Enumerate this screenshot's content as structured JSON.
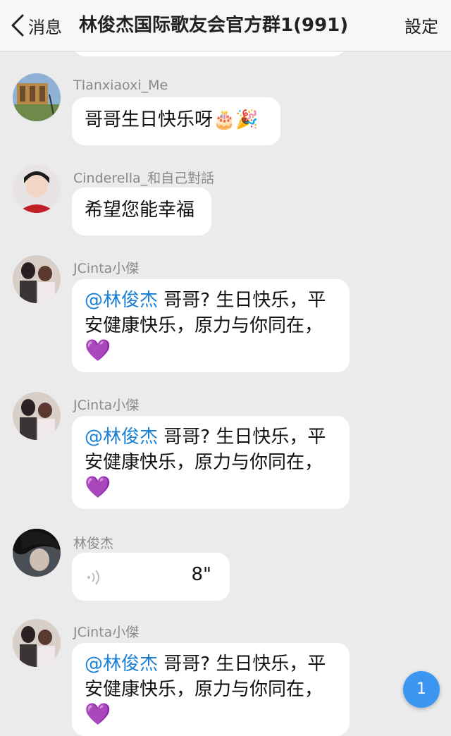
{
  "nav": {
    "back_label": "消息",
    "title": "林俊杰国际歌友会官方群1(991)",
    "settings_label": "設定"
  },
  "messages": [
    {
      "sender": "TIanxiaoxi_Me",
      "text": "哥哥生日快乐呀🎂🎉"
    },
    {
      "sender": "Cinderella_和自己對話",
      "text": "希望您能幸福"
    },
    {
      "sender": "JCinta小傑",
      "mention": "@林俊杰",
      "text_line1": " 哥哥? 生日快乐，平",
      "text_line2": "安健康快乐，原力与你同在，",
      "emoji": "💜"
    },
    {
      "sender": "JCinta小傑",
      "mention": "@林俊杰",
      "text_line1": " 哥哥? 生日快乐，平",
      "text_line2": "安健康快乐，原力与你同在，",
      "emoji": "💜"
    },
    {
      "sender": "林俊杰",
      "voice_duration": "8\""
    },
    {
      "sender": "JCinta小傑",
      "mention": "@林俊杰",
      "text_line1": " 哥哥? 生日快乐，平",
      "text_line2": "安健康快乐，原力与你同在，",
      "emoji": "💜"
    }
  ],
  "unread_count": "1",
  "colors": {
    "mention": "#1a7fd4",
    "badge": "#3b96f2",
    "background": "#ebebeb"
  }
}
